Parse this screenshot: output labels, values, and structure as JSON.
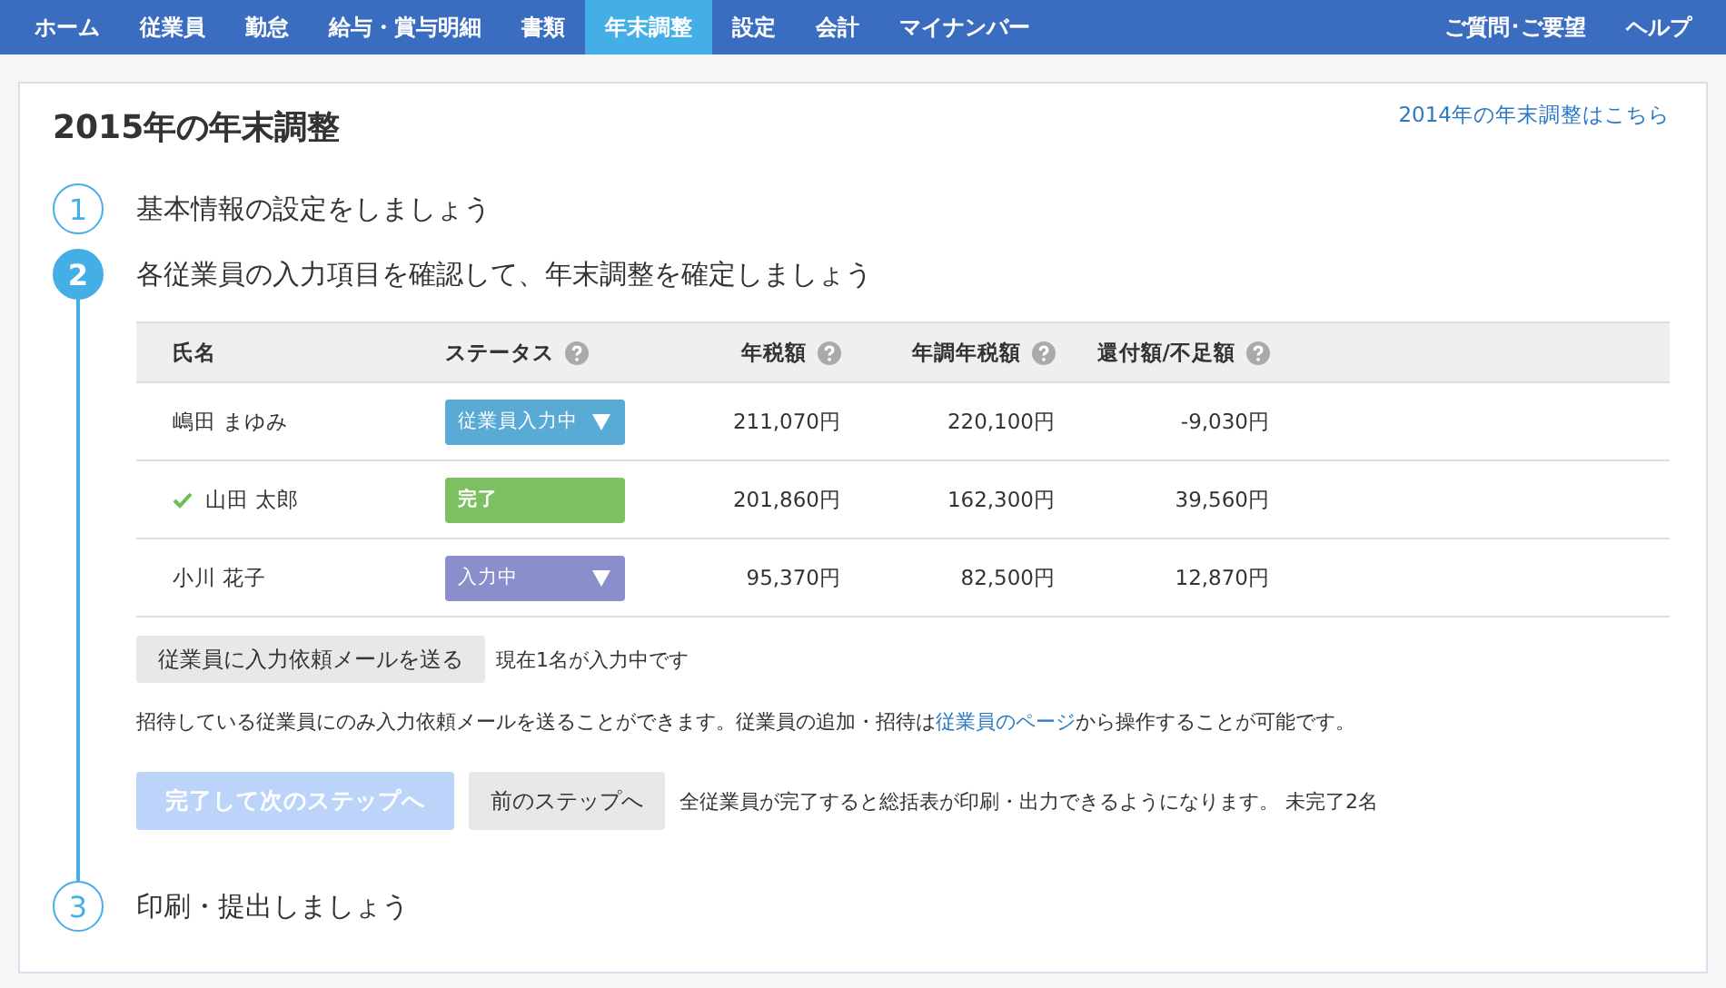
{
  "nav": {
    "items": [
      {
        "label": "ホーム",
        "selected": false
      },
      {
        "label": "従業員",
        "selected": false
      },
      {
        "label": "勤怠",
        "selected": false
      },
      {
        "label": "給与・賞与明細",
        "selected": false
      },
      {
        "label": "書類",
        "selected": false
      },
      {
        "label": "年末調整",
        "selected": true
      },
      {
        "label": "設定",
        "selected": false
      },
      {
        "label": "会計",
        "selected": false
      },
      {
        "label": "マイナンバー",
        "selected": false
      }
    ],
    "right_items": [
      "ご質問･ご要望",
      "ヘルプ"
    ]
  },
  "page": {
    "title": "2015年の年末調整",
    "previous_year_link": "2014年の年末調整はこちら"
  },
  "steps": [
    {
      "number": "1",
      "title": "基本情報の設定をしましょう",
      "active": false
    },
    {
      "number": "2",
      "title": "各従業員の入力項目を確認して、年末調整を確定しましょう",
      "active": true
    },
    {
      "number": "3",
      "title": "印刷・提出しましょう",
      "active": false
    }
  ],
  "table": {
    "columns": [
      {
        "label": "氏名",
        "help": false
      },
      {
        "label": "ステータス",
        "help": true
      },
      {
        "label": "年税額",
        "help": true
      },
      {
        "label": "年調年税額",
        "help": true
      },
      {
        "label": "還付額/不足額",
        "help": true
      }
    ],
    "rows": [
      {
        "name": "嶋田 まゆみ",
        "done": false,
        "status": "従業員入力中",
        "color": "#5aaad6",
        "dropdown": true,
        "tax": "211,070円",
        "adjusted_tax": "220,100円",
        "difference": "-9,030円"
      },
      {
        "name": "山田 太郎",
        "done": true,
        "status": "完了",
        "color": "#7cc063",
        "dropdown": false,
        "tax": "201,860円",
        "adjusted_tax": "162,300円",
        "difference": "39,560円"
      },
      {
        "name": "小川 花子",
        "done": false,
        "status": "入力中",
        "color": "#8a8fcb",
        "dropdown": true,
        "tax": "95,370円",
        "adjusted_tax": "82,500円",
        "difference": "12,870円"
      }
    ]
  },
  "request": {
    "button": "従業員に入力依頼メールを送る",
    "status": "現在1名が入力中です"
  },
  "note": {
    "before": "招待している従業員にのみ入力依頼メールを送ることができます。従業員の追加・招待は",
    "link": "従業員のページ",
    "after": "から操作することが可能です。"
  },
  "actions": {
    "next": {
      "label": "完了して次のステップへ",
      "disabled": true
    },
    "back": {
      "label": "前のステップへ"
    },
    "message": "全従業員が完了すると総括表が印刷・出力できるようになります。 未完了2名"
  }
}
